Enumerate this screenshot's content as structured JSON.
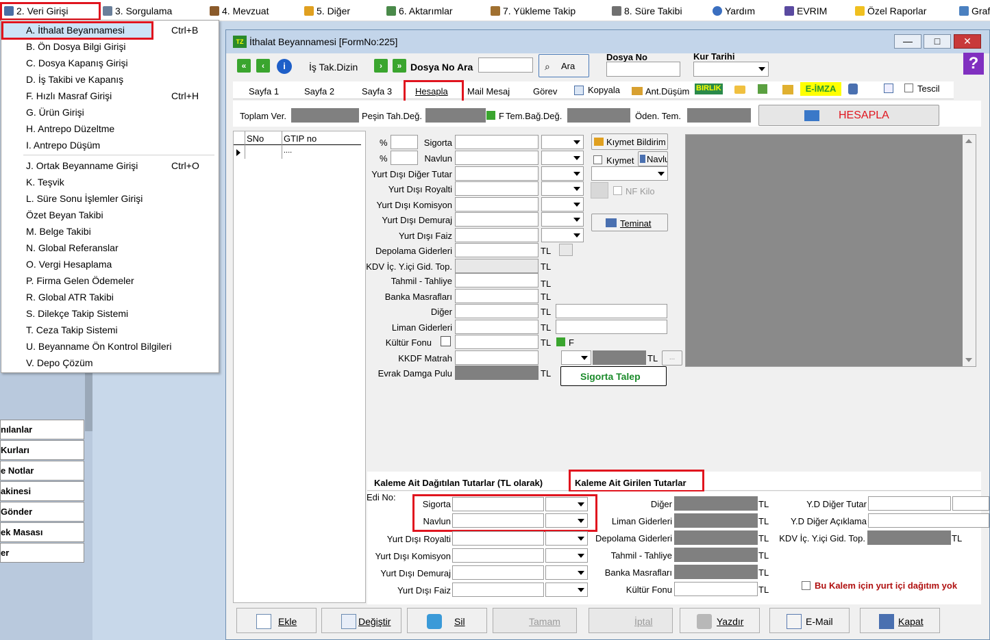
{
  "menubar": {
    "items": [
      {
        "label": "2.  Veri Girişi"
      },
      {
        "label": "3.  Sorgulama"
      },
      {
        "label": "4.  Mevzuat"
      },
      {
        "label": "5.  Diğer"
      },
      {
        "label": "6.  Aktarımlar"
      },
      {
        "label": "7.  Yükleme Takip"
      },
      {
        "label": "8. Süre Takibi"
      },
      {
        "label": "Yardım"
      },
      {
        "label": "EVRIM"
      },
      {
        "label": "Özel Raporlar"
      },
      {
        "label": "Graf"
      }
    ]
  },
  "dropdown": {
    "items": [
      {
        "label": "A.  İthalat Beyannamesi",
        "shortcut": "Ctrl+B"
      },
      {
        "label": "B.  Ön Dosya Bilgi Girişi",
        "shortcut": ""
      },
      {
        "label": "C.  Dosya Kapanış Girişi",
        "shortcut": ""
      },
      {
        "label": "D.  İş Takibi ve Kapanış",
        "shortcut": ""
      },
      {
        "label": "F.  Hızlı Masraf Girişi",
        "shortcut": "Ctrl+H"
      },
      {
        "label": "G.  Ürün Girişi",
        "shortcut": ""
      },
      {
        "label": "H.  Antrepo Düzeltme",
        "shortcut": ""
      },
      {
        "label": "I.   Antrepo Düşüm",
        "shortcut": ""
      },
      {
        "label": "J.  Ortak Beyanname Girişi",
        "shortcut": "Ctrl+O"
      },
      {
        "label": "K.  Teşvik",
        "shortcut": ""
      },
      {
        "label": "L.  Süre Sonu İşlemler Girişi",
        "shortcut": ""
      },
      {
        "label": "     Özet Beyan Takibi",
        "shortcut": ""
      },
      {
        "label": "M.   Belge Takibi",
        "shortcut": ""
      },
      {
        "label": "N.  Global Referanslar",
        "shortcut": ""
      },
      {
        "label": "O. Vergi Hesaplama",
        "shortcut": ""
      },
      {
        "label": "P. Firma Gelen Ödemeler",
        "shortcut": ""
      },
      {
        "label": "R. Global ATR Takibi",
        "shortcut": ""
      },
      {
        "label": "S. Dilekçe Takip Sistemi",
        "shortcut": ""
      },
      {
        "label": "T. Ceza Takip Sistemi",
        "shortcut": ""
      },
      {
        "label": "U. Beyanname Ön Kontrol Bilgileri",
        "shortcut": ""
      },
      {
        "label": "V. Depo Çözüm",
        "shortcut": ""
      }
    ]
  },
  "leftpanel": {
    "items": [
      "nılanlar",
      "Kurları",
      "e Notlar",
      "akinesi",
      "Gönder",
      "ek Masası",
      "er"
    ]
  },
  "window": {
    "title": "İthalat Beyannamesi [FormNo:225]",
    "min": "—",
    "max": "□",
    "close": "✕"
  },
  "toolbar": {
    "is_tak_dizin": "İş Tak.Dizin",
    "dosya_no_ara": "Dosya No Ara",
    "ara": "Ara",
    "dosya_no_label": "Dosya No",
    "kur_tarihi_label": "Kur Tarihi"
  },
  "tabs": {
    "sayfa1": "Sayfa 1",
    "sayfa2": "Sayfa 2",
    "sayfa3": "Sayfa 3",
    "hesapla": "Hesapla",
    "mail": "Mail Mesaj",
    "gorev": "Görev",
    "kopyala": "Kopyala",
    "antdusum": "Ant.Düşüm",
    "birlik": "BIRLIK",
    "eimza": "E-İMZA",
    "tescil": "Tescil"
  },
  "summary": {
    "toplam_ver": "Toplam Ver.",
    "pesin_tah": "Peşin Tah.Değ.",
    "f": "F",
    "tem_bag": "Tem.Bağ.Değ.",
    "oden_tem": "Öden. Tem.",
    "hesapla_btn": "HESAPLA"
  },
  "grid": {
    "col_sno": "SNo",
    "col_gtip": "GTIP no",
    "row1_gtip": "...."
  },
  "form": {
    "pct1": "%",
    "pct2": "%",
    "sigorta": "Sigorta",
    "navlun": "Navlun",
    "yd_diger_tutar": "Yurt Dışı Diğer Tutar",
    "yd_royalti": "Yurt Dışı Royalti",
    "yd_komisyon": "Yurt Dışı Komisyon",
    "yd_demuraj": "Yurt Dışı Demuraj",
    "yd_faiz": "Yurt Dışı Faiz",
    "depolama": "Depolama Giderleri",
    "kdv_ic": "KDV İç. Y.içi Gid. Top.",
    "tahmil": "Tahmil - Tahliye",
    "banka": "Banka Masrafları",
    "diger": "Diğer",
    "liman": "Liman Giderleri",
    "kultur": "Kültür Fonu",
    "kkdf": "KKDF Matrah",
    "evrak": "Evrak Damga Pulu",
    "tl": "TL",
    "f": "F",
    "kiymet_bildirim": "Kıymet Bildirim",
    "kiymet": "Kıymet",
    "navlu": "Navlu",
    "nf_kilo": "NF Kilo",
    "teminat": "Teminat",
    "sigorta_talep": "Sigorta Talep"
  },
  "kalem": {
    "tab1": "Kaleme Ait Dağıtılan Tutarlar (TL olarak)",
    "tab2": "Kaleme Ait Girilen Tutarlar",
    "edi_no": "Edi No:",
    "sigorta": "Sigorta",
    "navlun": "Navlun",
    "yd_royalti": "Yurt Dışı Royalti",
    "yd_komisyon": "Yurt Dışı Komisyon",
    "yd_demuraj": "Yurt Dışı Demuraj",
    "yd_faiz": "Yurt Dışı Faiz",
    "diger": "Diğer",
    "liman": "Liman Giderleri",
    "depolama": "Depolama Giderleri",
    "tahmil": "Tahmil - Tahliye",
    "banka": "Banka Masrafları",
    "kultur": "Kültür Fonu",
    "yd_diger_tutar": "Y.D Diğer Tutar",
    "yd_diger_aciklama": "Y.D Diğer Açıklama",
    "kdv_ic": "KDV İç. Y.içi Gid. Top.",
    "tl": "TL",
    "bu_kalem": "Bu Kalem için yurt içi dağıtım yok"
  },
  "bottom": {
    "ekle": "Ekle",
    "degistir": "Değiştir",
    "sil": "Sil",
    "tamam": "Tamam",
    "iptal": "İptal",
    "yazdir": "Yazdır",
    "email": "E-Mail",
    "kapat": "Kapat"
  }
}
